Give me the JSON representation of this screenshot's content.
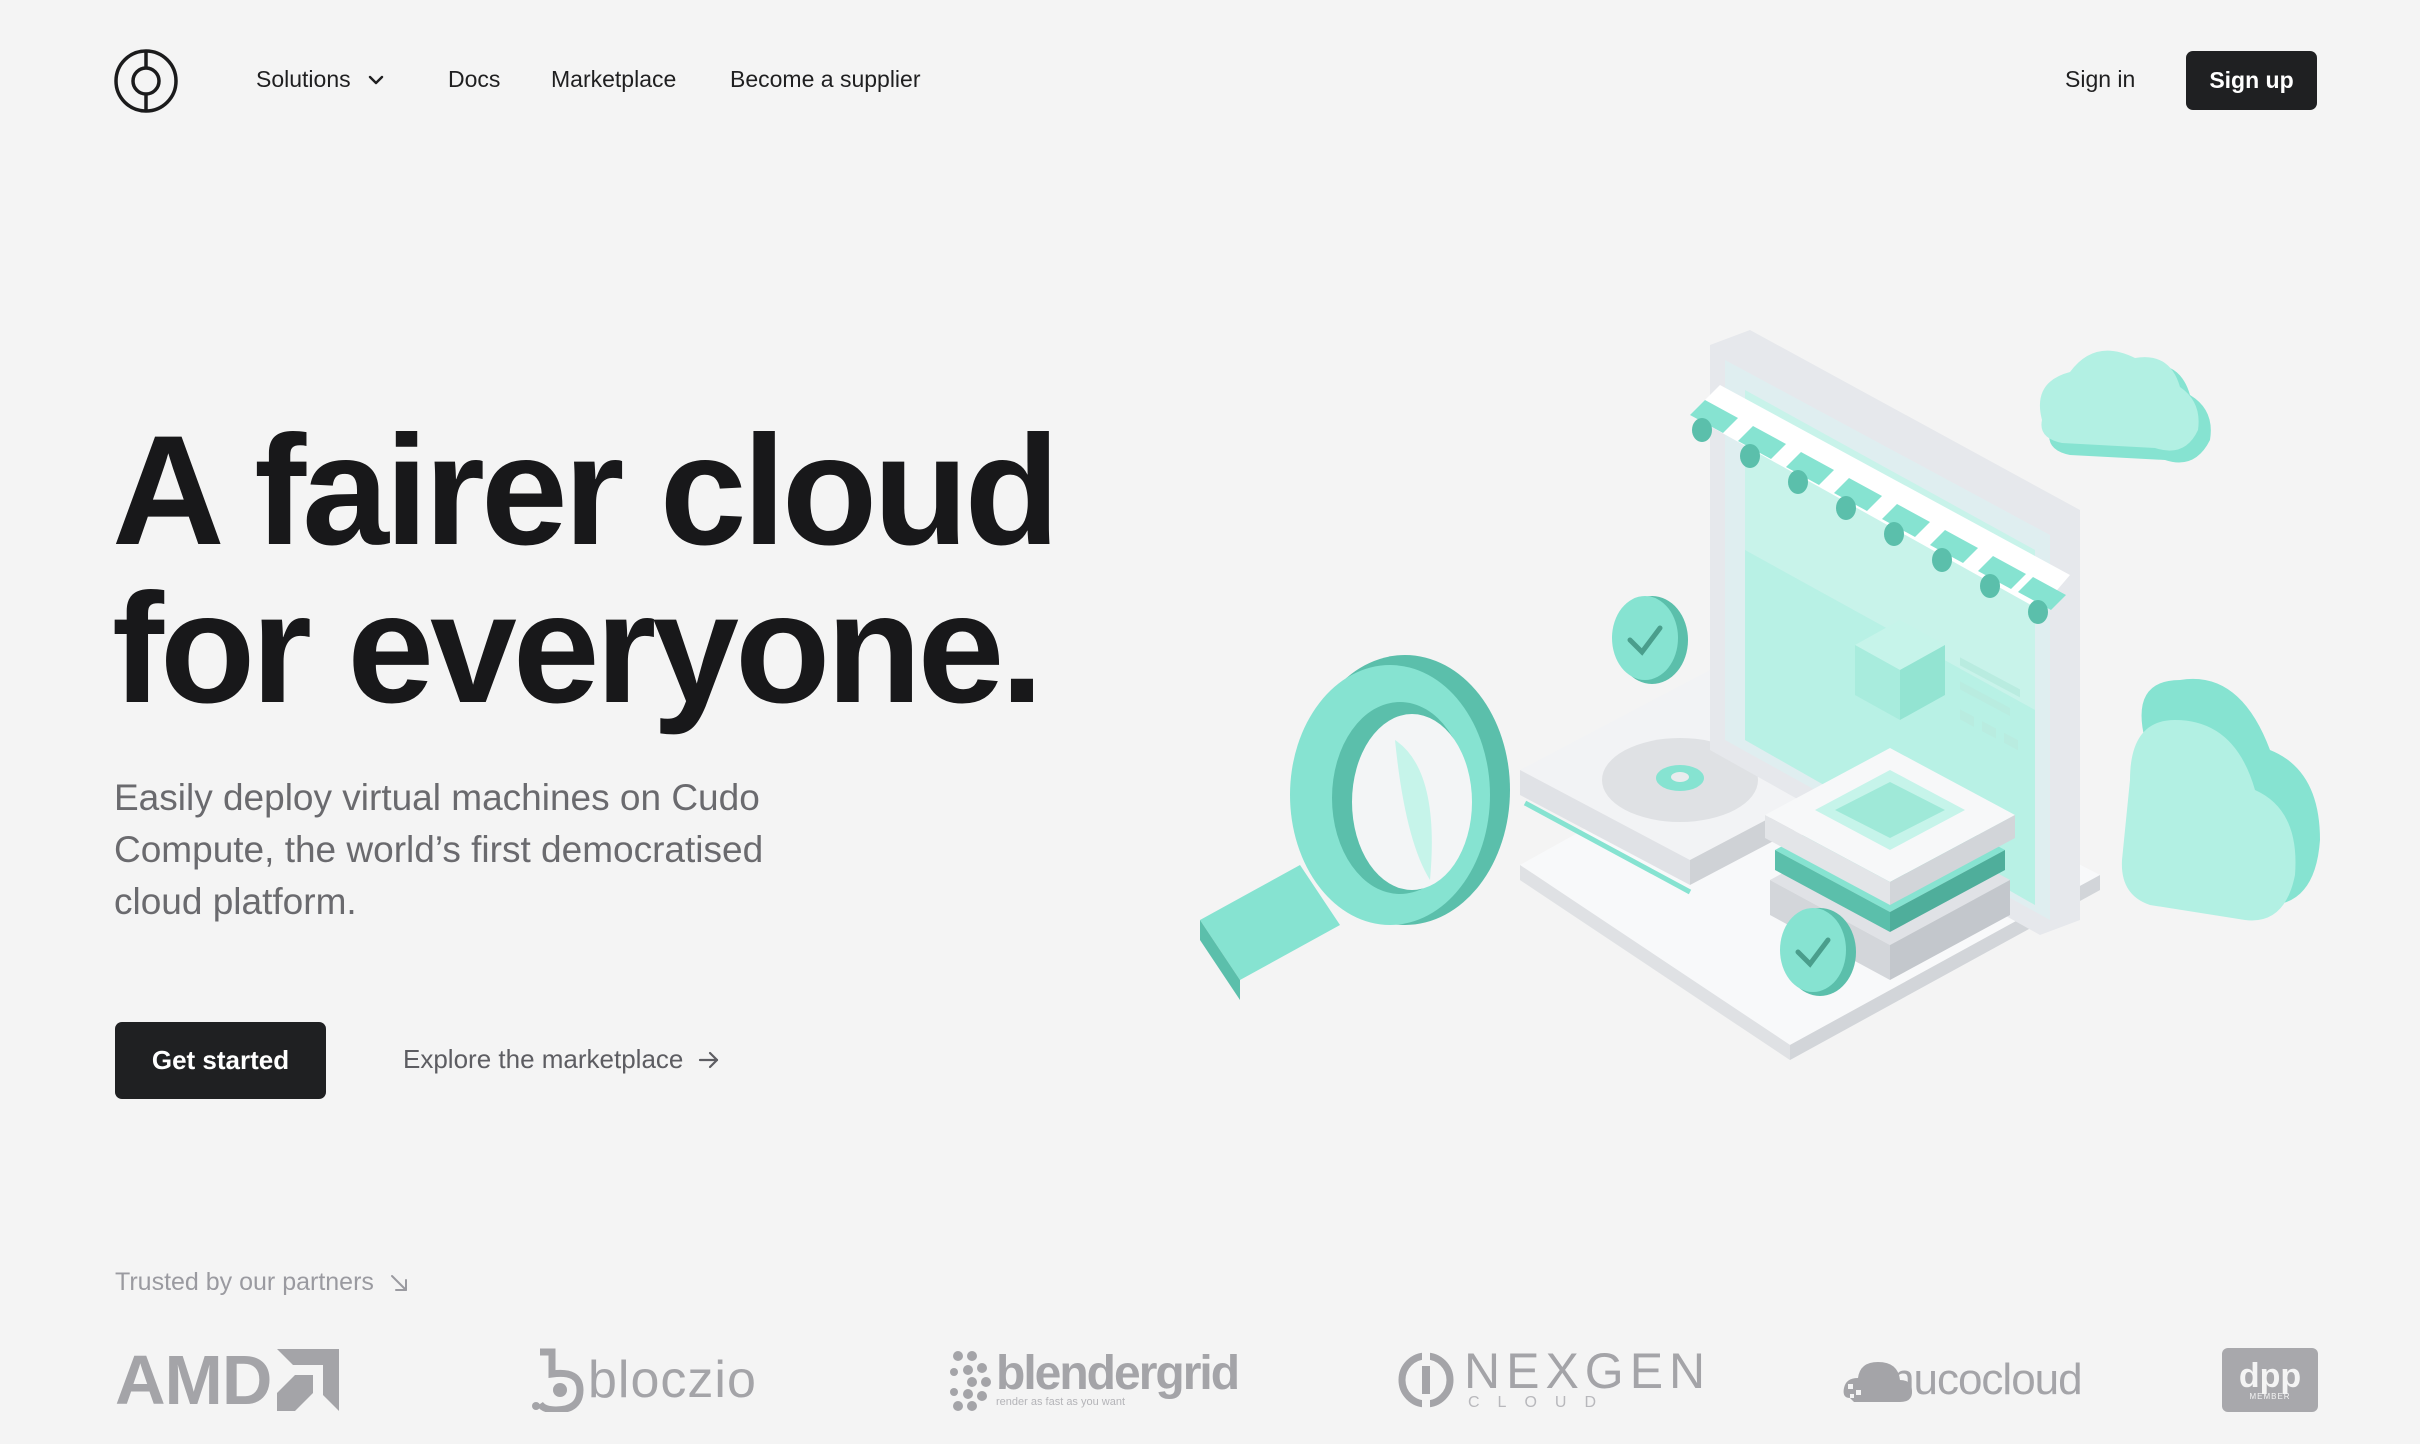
{
  "header": {
    "nav": [
      {
        "label": "Solutions",
        "has_dropdown": true
      },
      {
        "label": "Docs"
      },
      {
        "label": "Marketplace"
      },
      {
        "label": "Become a supplier"
      }
    ],
    "signin_label": "Sign in",
    "signup_label": "Sign up"
  },
  "hero": {
    "title_line1": "A fairer cloud",
    "title_line2": "for everyone.",
    "subtitle": "Easily deploy virtual machines on Cudo Compute, the world’s first democratised cloud platform.",
    "primary_cta": "Get started",
    "secondary_cta": "Explore the marketplace"
  },
  "partners": {
    "label": "Trusted by our partners",
    "logos": [
      {
        "name": "AMD",
        "text": "AMD"
      },
      {
        "name": "blocz",
        "text": "bloczio"
      },
      {
        "name": "blendergrid",
        "text": "blendergrid",
        "tagline": "render as fast as you want"
      },
      {
        "name": "nexgen",
        "text": "NEXGEN",
        "sub": "CLOUD"
      },
      {
        "name": "nucocloud",
        "text": "nucocloud"
      },
      {
        "name": "dpp",
        "text": "dpp",
        "sub": "MEMBER"
      }
    ]
  },
  "colors": {
    "accent": "#86e3d1",
    "accent_dark": "#5bbfab",
    "button_dark": "#1f2022",
    "background": "#f4f4f4"
  }
}
